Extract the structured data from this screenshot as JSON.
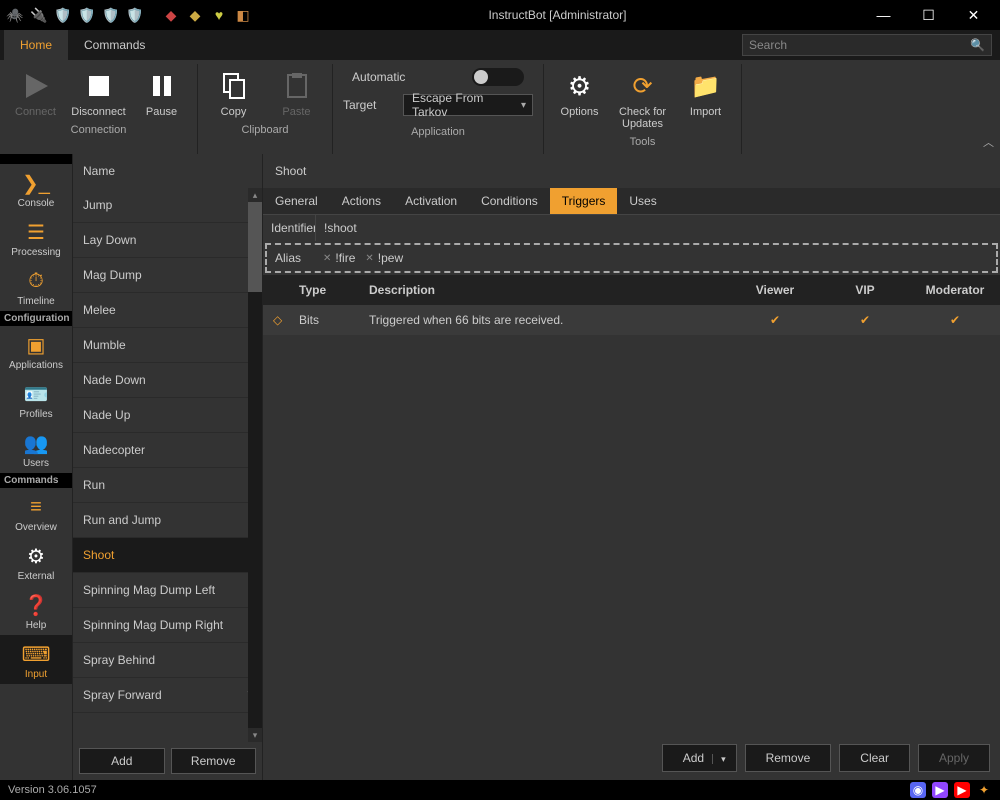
{
  "window": {
    "title": "InstructBot [Administrator]"
  },
  "main_tabs": {
    "home": "Home",
    "commands": "Commands"
  },
  "search": {
    "placeholder": "Search"
  },
  "ribbon": {
    "connection": {
      "label": "Connection",
      "connect": "Connect",
      "disconnect": "Disconnect",
      "pause": "Pause"
    },
    "clipboard": {
      "label": "Clipboard",
      "copy": "Copy",
      "paste": "Paste"
    },
    "application": {
      "label": "Application",
      "automatic": "Automatic",
      "target": "Target",
      "target_value": "Escape From Tarkov"
    },
    "tools": {
      "label": "Tools",
      "options": "Options",
      "check": "Check for Updates",
      "import": "Import"
    }
  },
  "sidebar": {
    "sections": {
      "top": "",
      "config": "Configuration",
      "commands": "Commands"
    },
    "items": {
      "console": "Console",
      "processing": "Processing",
      "timeline": "Timeline",
      "applications": "Applications",
      "profiles": "Profiles",
      "users": "Users",
      "overview": "Overview",
      "external": "External",
      "help": "Help",
      "input": "Input"
    }
  },
  "name_panel": {
    "header": "Name",
    "items": [
      "Jump",
      "Lay Down",
      "Mag Dump",
      "Melee",
      "Mumble",
      "Nade Down",
      "Nade Up",
      "Nadecopter",
      "Run",
      "Run and Jump",
      "Shoot",
      "Spinning Mag Dump Left",
      "Spinning Mag Dump Right",
      "Spray Behind",
      "Spray Forward"
    ],
    "selected": "Shoot",
    "add": "Add",
    "remove": "Remove"
  },
  "detail": {
    "title": "Shoot",
    "tabs": {
      "general": "General",
      "actions": "Actions",
      "activation": "Activation",
      "conditions": "Conditions",
      "triggers": "Triggers",
      "uses": "Uses"
    },
    "identifier_label": "Identifier",
    "identifier_value": "!shoot",
    "alias_label": "Alias",
    "aliases": [
      "!fire",
      "!pew"
    ],
    "table": {
      "headers": {
        "type": "Type",
        "desc": "Description",
        "viewer": "Viewer",
        "vip": "VIP",
        "mod": "Moderator"
      },
      "rows": [
        {
          "type": "Bits",
          "desc": "Triggered when 66 bits are received.",
          "viewer": true,
          "vip": true,
          "mod": true
        }
      ]
    },
    "footer": {
      "add": "Add",
      "remove": "Remove",
      "clear": "Clear",
      "apply": "Apply"
    }
  },
  "statusbar": {
    "version": "Version 3.06.1057"
  }
}
